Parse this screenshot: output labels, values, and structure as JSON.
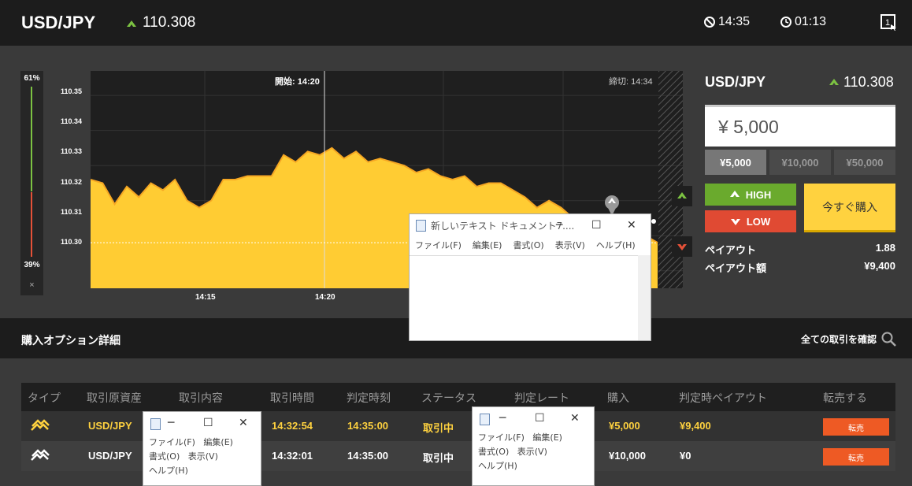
{
  "header": {
    "pair": "USD/JPY",
    "rate": "110.308",
    "clock": "14:35",
    "timer": "01:13",
    "window_count": "1"
  },
  "colors": {
    "up": "#7cc242",
    "down": "#e55138",
    "chart_fill": "#ffcc33",
    "chart_line": "#f5a623",
    "buy": "#ffd23f",
    "resell": "#ee5a24"
  },
  "sentiment": {
    "high_pct": "61%",
    "low_pct": "39%",
    "close": "×"
  },
  "chart": {
    "y_ticks": [
      "110.35",
      "110.34",
      "110.33",
      "110.32",
      "110.31",
      "110.30"
    ],
    "x_ticks": [
      "14:15",
      "14:20"
    ],
    "start_label": "開始: 14:20",
    "end_label": "締切: 14:34"
  },
  "chart_data": {
    "type": "area",
    "title": "",
    "xlabel": "",
    "ylabel": "",
    "x_ticks": [
      "14:15",
      "14:20"
    ],
    "ylim": [
      110.295,
      110.357
    ],
    "series": [
      {
        "values": [
          110.326,
          110.325,
          110.319,
          110.324,
          110.321,
          110.325,
          110.323,
          110.326,
          110.32,
          110.318,
          110.32,
          110.326,
          110.326,
          110.327,
          110.327,
          110.327,
          110.333,
          110.331,
          110.334,
          110.333,
          110.335,
          110.332,
          110.334,
          110.331,
          110.332,
          110.331,
          110.33,
          110.328,
          110.329,
          110.327,
          110.326,
          110.327,
          110.324,
          110.325,
          110.325,
          110.323,
          110.321,
          110.318,
          110.32,
          110.318,
          110.315,
          110.316,
          110.313,
          110.314,
          110.312,
          110.313,
          110.31,
          110.308
        ]
      }
    ]
  },
  "trade_panel": {
    "pair": "USD/JPY",
    "rate": "110.308",
    "amount": "¥ 5,000",
    "presets": [
      "¥5,000",
      "¥10,000",
      "¥50,000"
    ],
    "high_label": "HIGH",
    "low_label": "LOW",
    "buy_label": "今すぐ購入",
    "payout_label": "ペイアウト",
    "payout_value": "1.88",
    "payout_amount_label": "ペイアウト額",
    "payout_amount_value": "¥9,400"
  },
  "details": {
    "title": "購入オプション詳細",
    "view_all": "全ての取引を確認"
  },
  "table": {
    "headers": [
      "タイプ",
      "取引原資産",
      "取引内容",
      "取引時間",
      "判定時刻",
      "ステータス",
      "判定レート",
      "購入",
      "判定時ペイアウト",
      "転売する"
    ],
    "rows": [
      {
        "asset": "USD/JPY",
        "time": "14:32:54",
        "judge": "14:35:00",
        "status": "取引中",
        "buy": "¥5,000",
        "payout": "¥9,400",
        "resell": "転売"
      },
      {
        "asset": "USD/JPY",
        "time": "14:32:01",
        "judge": "14:35:00",
        "status": "取引中",
        "buy": "¥10,000",
        "payout": "¥0",
        "resell": "転売"
      }
    ]
  },
  "notepad_main": {
    "title": "新しいテキスト ドキュメント7....",
    "menu": [
      "ファイル(F)",
      "編集(E)",
      "書式(O)",
      "表示(V)",
      "ヘルプ(H)"
    ]
  },
  "notepad_small1": {
    "menu": [
      "ファイル(F)",
      "編集(E)",
      "書式(O)",
      "表示(V)",
      "ヘルプ(H)"
    ]
  },
  "notepad_small2": {
    "menu": [
      "ファイル(F)",
      "編集(E)",
      "書式(O)",
      "表示(V)",
      "ヘルプ(H)"
    ]
  }
}
